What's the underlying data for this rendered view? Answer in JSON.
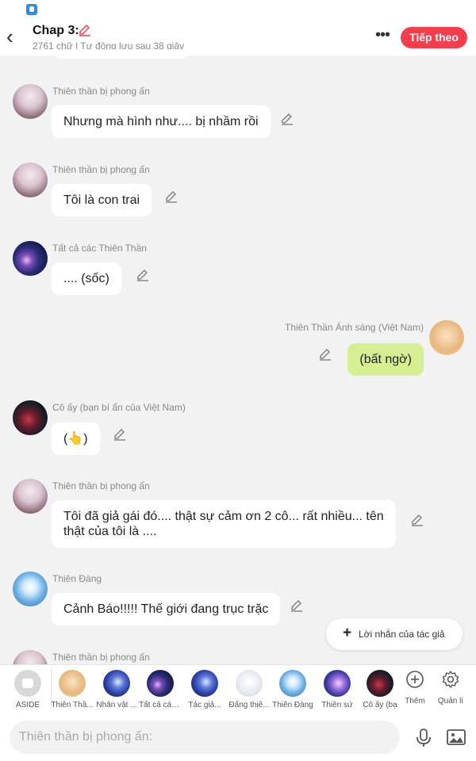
{
  "header": {
    "title": "Chap 3:",
    "subtitle": "2761 chữ | Tự động lưu sau 38 giây",
    "next_label": "Tiếp theo",
    "accent": "#f53d4c"
  },
  "messages": [
    {
      "sender": "Thiên thần bị phong ấn",
      "text": "Nhưng mà hình như.... bị nhầm rồi",
      "side": "left",
      "avatar_icon": "angel-avatar"
    },
    {
      "sender": "Thiên thần bị phong ấn",
      "text": "Tôi là con trai",
      "side": "left",
      "avatar_icon": "angel-avatar"
    },
    {
      "sender": "Tất cả các Thiên Thần",
      "text": ".... (sốc)",
      "side": "left",
      "avatar_icon": "galaxy-avatar"
    },
    {
      "sender": "Thiên Thần Ánh sáng (Việt Nam)",
      "text": "(bất ngờ)",
      "side": "right",
      "avatar_icon": "girl-avatar",
      "bubble_color": "#d7ef93"
    },
    {
      "sender": "Cô ấy (bạn bí ẩn của Việt Nam)",
      "text": "(👆)",
      "side": "left",
      "avatar_icon": "dark-avatar"
    },
    {
      "sender": "Thiên thần bị phong ấn",
      "text": "Tôi đã giả gái đó.... thật sự cảm ơn 2 cô... rất nhiều... tên thật của tôi là ....",
      "side": "left",
      "avatar_icon": "angel-avatar"
    },
    {
      "sender": "Thiên Đàng",
      "text": "Cảnh Báo!!!!! Thế giới đang trục trặc",
      "side": "left",
      "avatar_icon": "sky-avatar"
    },
    {
      "sender": "Thiên thần bị phong ấn",
      "text": "",
      "side": "left",
      "avatar_icon": "angel-avatar"
    }
  ],
  "float_button": {
    "label": "Lời nhắn của tác giả"
  },
  "characters": [
    {
      "label": "ASIDE"
    },
    {
      "label": "Thiên Thầ..."
    },
    {
      "label": "Nhân vật ..."
    },
    {
      "label": "Tất cả các..."
    },
    {
      "label": "Tác giả..."
    },
    {
      "label": "Đấng thiê..."
    },
    {
      "label": "Thiên Đàng"
    },
    {
      "label": "Thiên sứ"
    },
    {
      "label": "Cô ấy (bạ"
    }
  ],
  "tools": {
    "add_label": "Thêm",
    "manage_label": "Quản lí"
  },
  "composer": {
    "placeholder": "Thiên thần bị phong ấn:"
  }
}
